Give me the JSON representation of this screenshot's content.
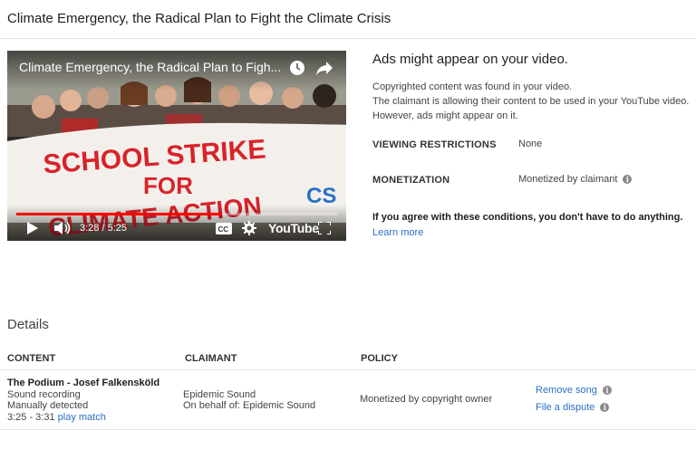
{
  "page": {
    "title": "Climate Emergency, the Radical Plan to Fight the Climate Crisis"
  },
  "player": {
    "video_title": "Climate Emergency, the Radical Plan to Figh...",
    "banner_line1": "SCHOOL STRIKE",
    "banner_line2": "FOR",
    "banner_line3": "CLIMATE ACTION",
    "channel_badge": "CS",
    "time_current": "3:28",
    "time_separator": "/",
    "time_total": "5:25",
    "progress_fraction": 0.64,
    "logo_text": "YouTube",
    "icons": [
      "play-icon",
      "volume-icon",
      "cc-icon",
      "gear-icon",
      "fullscreen-icon",
      "clock-icon",
      "share-icon"
    ]
  },
  "info": {
    "heading": "Ads might appear on your video.",
    "line1": "Copyrighted content was found in your video.",
    "line2": "The claimant is allowing their content to be used in your YouTube video.",
    "line3": "However, ads might appear on it.",
    "viewing_label": "VIEWING RESTRICTIONS",
    "viewing_value": "None",
    "monetization_label": "MONETIZATION",
    "monetization_value": "Monetized by claimant",
    "agree_text": "If you agree with these conditions, you don't have to do anything.",
    "learn_more": "Learn more"
  },
  "details": {
    "heading": "Details",
    "columns": {
      "content": "CONTENT",
      "claimant": "CLAIMANT",
      "policy": "POLICY"
    },
    "row": {
      "content_title": "The Podium - Josef Falkenskö​ld",
      "content_type": "Sound recording",
      "detection": "Manually detected",
      "time_range": "3:25 - 3:31",
      "play_match": "play match",
      "claimant": "Epidemic Sound",
      "claimant_behalf": "On behalf of: Epidemic Sound",
      "policy": "Monetized by copyright owner",
      "remove_song": "Remove song",
      "file_dispute": "File a dispute"
    }
  },
  "colors": {
    "link": "#2b6fc7",
    "progress": "#ff0000",
    "banner_text": "#d8232a"
  }
}
